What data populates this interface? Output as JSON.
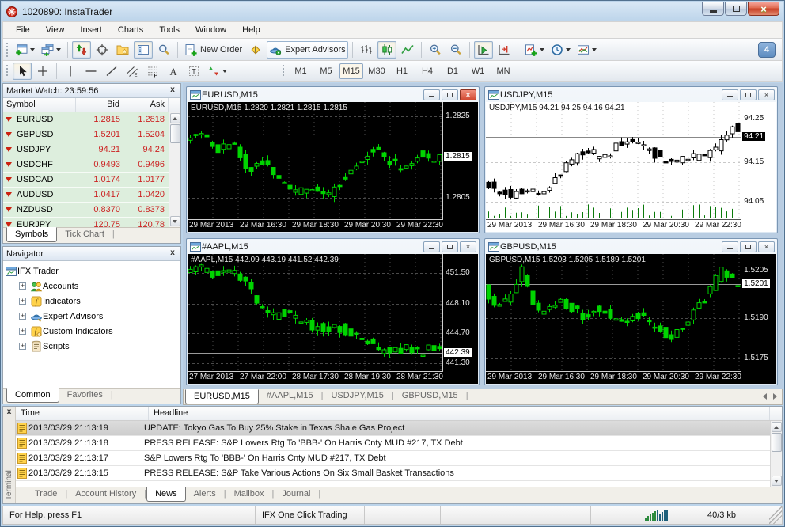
{
  "window": {
    "title": "1020890: InstaTrader"
  },
  "menu": [
    "File",
    "View",
    "Insert",
    "Charts",
    "Tools",
    "Window",
    "Help"
  ],
  "toolbar1": [
    {
      "id": "new-chart",
      "icon": "new-chart",
      "drop": true
    },
    {
      "id": "profiles",
      "icon": "profiles",
      "drop": true
    },
    {
      "sep": true
    },
    {
      "id": "tick-chart",
      "icon": "updown",
      "active": true
    },
    {
      "id": "crosshair-mode",
      "icon": "target"
    },
    {
      "id": "favorites",
      "icon": "folder-star"
    },
    {
      "id": "market-watch-toggle",
      "icon": "panel",
      "active": true
    },
    {
      "id": "preview-search",
      "icon": "magnifier"
    },
    {
      "sep": true
    },
    {
      "id": "new-order",
      "icon": "new-order",
      "label": "New Order"
    },
    {
      "id": "alerts",
      "icon": "warning"
    },
    {
      "id": "expert-advisors",
      "icon": "ea-hat",
      "label": "Expert Advisors",
      "boxed": true
    },
    {
      "sep": true
    },
    {
      "id": "bar-chart",
      "icon": "bars"
    },
    {
      "id": "candlestick-chart",
      "icon": "candles",
      "active": true
    },
    {
      "id": "line-chart",
      "icon": "linechart"
    },
    {
      "sep": true
    },
    {
      "id": "zoom-in",
      "icon": "zoom-in"
    },
    {
      "id": "zoom-out",
      "icon": "zoom-out"
    },
    {
      "sep": true
    },
    {
      "id": "auto-scroll",
      "icon": "autoscroll",
      "active": true
    },
    {
      "id": "chart-shift",
      "icon": "chartshift"
    },
    {
      "sep": true
    },
    {
      "id": "indicators",
      "icon": "indicator-add",
      "drop": true
    },
    {
      "id": "periods",
      "icon": "clock",
      "drop": true
    },
    {
      "id": "templates",
      "icon": "template",
      "drop": true
    }
  ],
  "notification_count": "4",
  "toolbar2": [
    {
      "id": "cursor",
      "icon": "cursor",
      "active": true
    },
    {
      "id": "crosshair-tool",
      "icon": "cross"
    },
    {
      "sep": true
    },
    {
      "id": "vertical-line",
      "icon": "vline"
    },
    {
      "id": "horizontal-line",
      "icon": "hline"
    },
    {
      "id": "trendline",
      "icon": "trend"
    },
    {
      "id": "equidistant-channel",
      "icon": "channel"
    },
    {
      "id": "fibonacci",
      "icon": "fibo"
    },
    {
      "id": "text",
      "icon": "textA"
    },
    {
      "id": "text-label",
      "icon": "labelT"
    },
    {
      "id": "arrows",
      "icon": "shapes",
      "drop": true
    }
  ],
  "timeframes": {
    "items": [
      "M1",
      "M5",
      "M15",
      "M30",
      "H1",
      "H4",
      "D1",
      "W1",
      "MN"
    ],
    "active": "M15"
  },
  "market_watch": {
    "title": "Market Watch: 23:59:56",
    "columns": [
      "Symbol",
      "Bid",
      "Ask"
    ],
    "rows": [
      {
        "symbol": "EURUSD",
        "bid": "1.2815",
        "ask": "1.2818"
      },
      {
        "symbol": "GBPUSD",
        "bid": "1.5201",
        "ask": "1.5204"
      },
      {
        "symbol": "USDJPY",
        "bid": "94.21",
        "ask": "94.24"
      },
      {
        "symbol": "USDCHF",
        "bid": "0.9493",
        "ask": "0.9496"
      },
      {
        "symbol": "USDCAD",
        "bid": "1.0174",
        "ask": "1.0177"
      },
      {
        "symbol": "AUDUSD",
        "bid": "1.0417",
        "ask": "1.0420"
      },
      {
        "symbol": "NZDUSD",
        "bid": "0.8370",
        "ask": "0.8373"
      },
      {
        "symbol": "EURJPY",
        "bid": "120.75",
        "ask": "120.78"
      }
    ],
    "tabs": [
      {
        "label": "Symbols",
        "active": true
      },
      {
        "label": "Tick Chart",
        "active": false
      }
    ]
  },
  "navigator": {
    "title": "Navigator",
    "root": "IFX Trader",
    "items": [
      {
        "label": "Accounts",
        "icon": "accounts"
      },
      {
        "label": "Indicators",
        "icon": "indicators"
      },
      {
        "label": "Expert Advisors",
        "icon": "experts"
      },
      {
        "label": "Custom Indicators",
        "icon": "custom"
      },
      {
        "label": "Scripts",
        "icon": "scripts"
      }
    ],
    "tabs": [
      {
        "label": "Common",
        "active": true
      },
      {
        "label": "Favorites",
        "active": false
      }
    ]
  },
  "chart_data": [
    {
      "type": "candlestick",
      "symbol": "EURUSD",
      "timeframe": "M15",
      "window_title": "EURUSD,M15",
      "info_line": "EURUSD,M15  1.2820 1.2821 1.2815 1.2815",
      "ohlc": {
        "open": "1.2820",
        "high": "1.2821",
        "low": "1.2815",
        "close": "1.2815"
      },
      "theme": "dark",
      "active": true,
      "has_volume": false,
      "seed": 11,
      "y_ticks": [
        {
          "label": "1.2825",
          "frac": 0.12
        },
        {
          "label": "1.2815",
          "frac": 0.47,
          "badge": true
        },
        {
          "label": "1.2805",
          "frac": 0.82
        }
      ],
      "x_ticks": [
        "29 Mar 2013",
        "29 Mar 16:30",
        "29 Mar 18:30",
        "29 Mar 20:30",
        "29 Mar 22:30"
      ],
      "anchors": [
        0.68,
        0.75,
        0.6,
        0.64,
        0.42,
        0.5,
        0.3,
        0.18,
        0.24,
        0.16,
        0.3,
        0.45,
        0.62,
        0.5,
        0.42,
        0.55,
        0.52
      ]
    },
    {
      "type": "candlestick",
      "symbol": "USDJPY",
      "timeframe": "M15",
      "window_title": "USDJPY,M15",
      "info_line": "USDJPY,M15  94.21 94.25 94.16 94.21",
      "ohlc": {
        "open": "94.21",
        "high": "94.25",
        "low": "94.16",
        "close": "94.21"
      },
      "theme": "light",
      "active": false,
      "has_volume": true,
      "seed": 22,
      "y_ticks": [
        {
          "label": "94.25",
          "frac": 0.14
        },
        {
          "label": "94.21",
          "frac": 0.3,
          "badge": true
        },
        {
          "label": "94.15",
          "frac": 0.52
        },
        {
          "label": "94.05",
          "frac": 0.86
        }
      ],
      "x_ticks": [
        "29 Mar 2013",
        "29 Mar 16:30",
        "29 Mar 18:30",
        "29 Mar 20:30",
        "29 Mar 22:30"
      ],
      "anchors": [
        0.28,
        0.22,
        0.18,
        0.25,
        0.2,
        0.35,
        0.5,
        0.58,
        0.52,
        0.62,
        0.68,
        0.6,
        0.52,
        0.48,
        0.55,
        0.5,
        0.62,
        0.8
      ]
    },
    {
      "type": "candlestick",
      "symbol": "#AAPL",
      "timeframe": "M15",
      "window_title": "#AAPL,M15",
      "info_line": "#AAPL,M15  442.09 443.19 441.52 442.39",
      "ohlc": {
        "open": "442.09",
        "high": "443.19",
        "low": "441.52",
        "close": "442.39"
      },
      "theme": "dark",
      "active": false,
      "has_volume": false,
      "seed": 33,
      "y_ticks": [
        {
          "label": "451.50",
          "frac": 0.16
        },
        {
          "label": "448.10",
          "frac": 0.43
        },
        {
          "label": "444.70",
          "frac": 0.68
        },
        {
          "label": "442.39",
          "frac": 0.85,
          "badge": true
        },
        {
          "label": "441.30",
          "frac": 0.94
        }
      ],
      "x_ticks": [
        "27 Mar 2013",
        "27 Mar 22:00",
        "28 Mar 17:30",
        "28 Mar 19:30",
        "28 Mar 21:30"
      ],
      "anchors": [
        0.86,
        0.9,
        0.85,
        0.88,
        0.82,
        0.62,
        0.45,
        0.5,
        0.42,
        0.38,
        0.33,
        0.36,
        0.28,
        0.22,
        0.15,
        0.12,
        0.16,
        0.12,
        0.17
      ]
    },
    {
      "type": "candlestick",
      "symbol": "GBPUSD",
      "timeframe": "M15",
      "window_title": "GBPUSD,M15",
      "info_line": "GBPUSD,M15  1.5203 1.5205 1.5189 1.5201",
      "ohlc": {
        "open": "1.5203",
        "high": "1.5205",
        "low": "1.5189",
        "close": "1.5201"
      },
      "theme": "dark",
      "active": false,
      "has_volume": false,
      "seed": 44,
      "y_ticks": [
        {
          "label": "1.5205",
          "frac": 0.14
        },
        {
          "label": "1.5201",
          "frac": 0.26,
          "badge": true
        },
        {
          "label": "1.5190",
          "frac": 0.55
        },
        {
          "label": "1.5175",
          "frac": 0.9
        }
      ],
      "x_ticks": [
        "29 Mar 2013",
        "29 Mar 16:30",
        "29 Mar 18:30",
        "29 Mar 20:30",
        "29 Mar 22:30"
      ],
      "anchors": [
        0.72,
        0.52,
        0.62,
        0.88,
        0.55,
        0.48,
        0.6,
        0.52,
        0.44,
        0.56,
        0.48,
        0.38,
        0.5,
        0.42,
        0.32,
        0.28,
        0.35,
        0.52,
        0.68,
        0.88,
        0.78
      ]
    }
  ],
  "chart_tabs": [
    {
      "label": "EURUSD,M15",
      "active": true
    },
    {
      "label": "#AAPL,M15",
      "active": false
    },
    {
      "label": "USDJPY,M15",
      "active": false
    },
    {
      "label": "GBPUSD,M15",
      "active": false
    }
  ],
  "terminal": {
    "side_label": "Terminal",
    "columns": [
      "Time",
      "Headline"
    ],
    "rows": [
      {
        "time": "2013/03/29 21:13:19",
        "headline": "UPDATE: Tokyo Gas To Buy 25% Stake in Texas Shale Gas Project",
        "selected": true
      },
      {
        "time": "2013/03/29 21:13:18",
        "headline": "PRESS RELEASE: S&P Lowers Rtg To 'BBB-' On Harris Cnty MUD #217, TX Debt",
        "selected": false
      },
      {
        "time": "2013/03/29 21:13:17",
        "headline": "S&P Lowers Rtg To 'BBB-' On Harris Cnty MUD #217, TX Debt",
        "selected": false
      },
      {
        "time": "2013/03/29 21:13:15",
        "headline": "PRESS RELEASE: S&P Take Various Actions On Six Small Basket Transactions",
        "selected": false
      }
    ],
    "tabs": [
      {
        "label": "Trade",
        "active": false
      },
      {
        "label": "Account History",
        "active": false
      },
      {
        "label": "News",
        "active": true
      },
      {
        "label": "Alerts",
        "active": false
      },
      {
        "label": "Mailbox",
        "active": false
      },
      {
        "label": "Journal",
        "active": false
      }
    ]
  },
  "status_bar": {
    "help": "For Help, press F1",
    "one_click": "IFX One Click Trading",
    "traffic": "40/3 kb"
  },
  "colors": {
    "up_candle_dark": "#00d400",
    "candle_light": "#000000",
    "price_text": "#cc2222",
    "row_green": "#ddeedd",
    "chart_bg_dark": "#000000",
    "chart_bg_light": "#ffffff"
  }
}
